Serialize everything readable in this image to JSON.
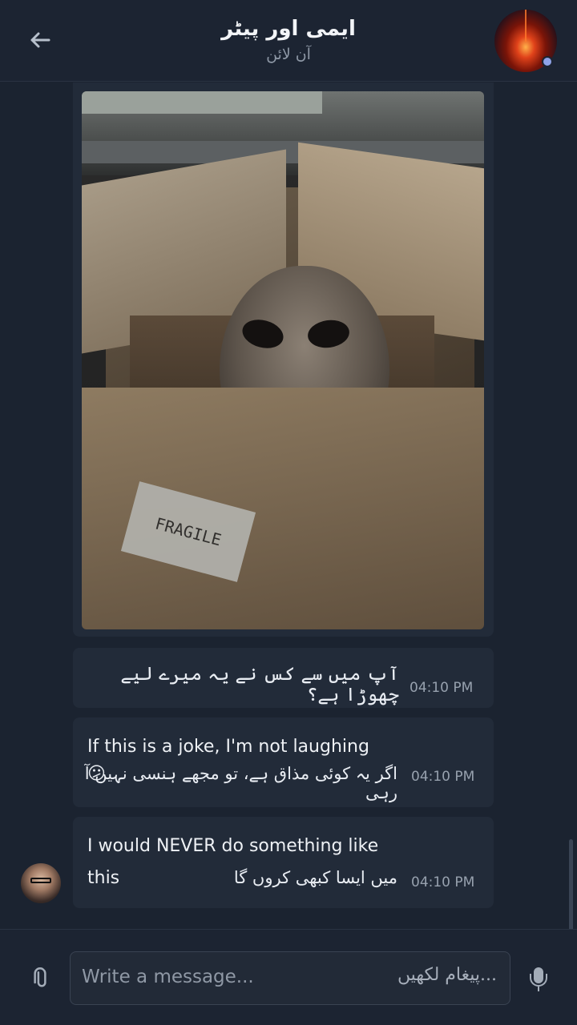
{
  "header": {
    "back_icon": "arrow-left-icon",
    "title": "ایمی اور پیٹر",
    "status": "آن لائن",
    "avatar_icon": "group-avatar-image"
  },
  "messages": [
    {
      "type": "image",
      "image_caption_text": "FRAGILE"
    },
    {
      "urdu": "آپ میں سے کس نے یہ میرے لیے چھوڑا ہے؟",
      "time": "04:10 PM"
    },
    {
      "english": "If this is a joke, I'm not laughing",
      "emoji": "😕",
      "urdu": "اگر یہ کوئی مذاق ہے، تو مجھے ہنسی نہیں آ رہی",
      "time": "04:10 PM"
    },
    {
      "english_line1": "I would NEVER do something like",
      "english_line2": "this",
      "urdu": "میں ایسا کبھی کروں گا",
      "time": "04:10 PM",
      "sender_avatar_icon": "sender-avatar-image"
    }
  ],
  "composer": {
    "placeholder": "Write a message...",
    "placeholder_urdu": "پیغام لکھیں...",
    "attach_icon": "paperclip-icon",
    "mic_icon": "microphone-icon"
  },
  "colors": {
    "background": "#1b2330",
    "bubble": "#222b39",
    "accent_dot": "#8fa3e8"
  }
}
